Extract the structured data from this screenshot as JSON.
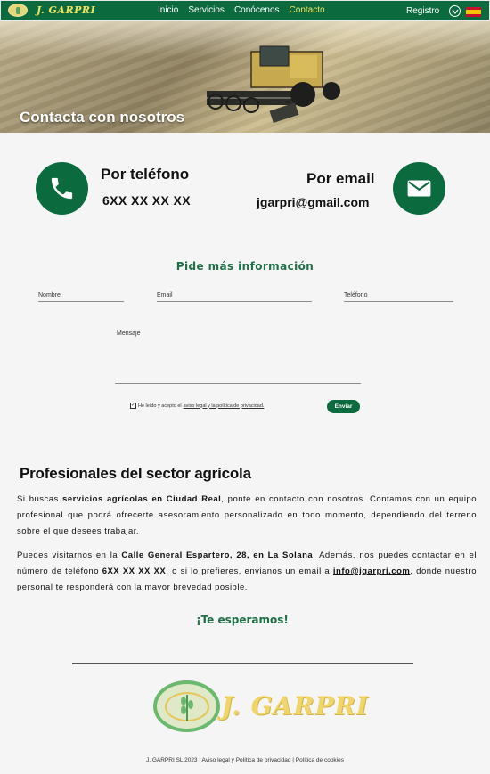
{
  "nav": {
    "brand": "J. GARPRI",
    "links": [
      "Inicio",
      "Servicios",
      "Conócenos",
      "Contacto"
    ],
    "active_link": "Contacto",
    "register": "Registro"
  },
  "hero": {
    "title": "Contacta con nosotros"
  },
  "contact": {
    "phone_title": "Por teléfono",
    "phone_number": "6XX XX XX XX",
    "email_title": "Por email",
    "email_address": "jgarpri@gmail.com"
  },
  "form": {
    "title": "Pide más información",
    "name_placeholder": "Nombre",
    "email_placeholder": "Email",
    "phone_placeholder": "Teléfono",
    "message_placeholder": "Mensaje",
    "consent_text": "He leído y acepto el",
    "consent_link": "aviso legal y la política de privacidad.",
    "submit": "Enviar"
  },
  "about": {
    "title": "Profesionales del sector agrícola",
    "p1_a": "Si buscas ",
    "p1_b": "servicios agrícolas en Ciudad Real",
    "p1_c": ", ponte en contacto con nosotros. Contamos con un equipo profesional que podrá ofrecerte asesoramiento personalizado en todo momento, dependiendo del terreno sobre el que desees trabajar.",
    "p2_a": "Puedes visitarnos en la ",
    "p2_b": "Calle General Espartero, 28, en La Solana",
    "p2_c": ". Además, nos puedes contactar en el número de teléfono ",
    "p2_d": "6XX XX XX XX",
    "p2_e": ", o si lo prefieres, envianos un email a ",
    "p2_f": "info@jgarpri.com",
    "p2_g": ", donde nuestro personal te responderá con la mayor brevedad posible.",
    "closing": "¡Te esperamos!"
  },
  "footer": {
    "logo_text": "J. GARPRI",
    "company": "J. GARPRI SL 2023",
    "legal": "Aviso legal y Política de privacidad",
    "cookies": "Política de cookies",
    "separator": " | "
  },
  "colors": {
    "brand_green": "#0b6b3f",
    "accent_yellow": "#f3e463",
    "heading_green": "#1f6f47"
  }
}
